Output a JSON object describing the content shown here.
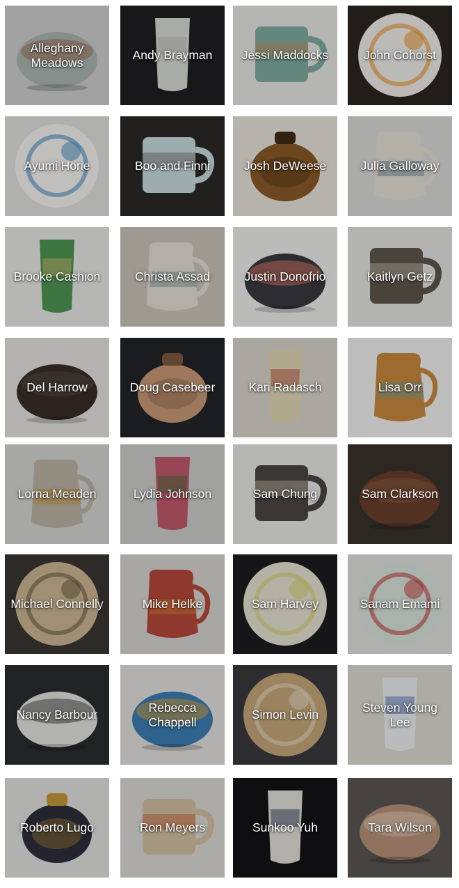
{
  "artists": [
    {
      "name": "Alleghany Meadows",
      "colors": {
        "bg": "#cfd0cf",
        "piece": "#aeb8b4",
        "accent": "#9c7156"
      },
      "shape": "bowl"
    },
    {
      "name": "Andy Brayman",
      "colors": {
        "bg": "#1f1f22",
        "piece": "#d9dbd7",
        "accent": "#b9bcb7"
      },
      "shape": "vase"
    },
    {
      "name": "Jessi Maddocks",
      "colors": {
        "bg": "#e8e8e6",
        "piece": "#7fae9f",
        "accent": "#c9925f"
      },
      "shape": "mug"
    },
    {
      "name": "John Cohorst",
      "colors": {
        "bg": "#2d2620",
        "piece": "#f0efe9",
        "accent": "#e7952d"
      },
      "shape": "plate"
    },
    {
      "name": "Ayumi Horie",
      "colors": {
        "bg": "#e2e2e0",
        "piece": "#f6f5f1",
        "accent": "#4a8fc2"
      },
      "shape": "plate"
    },
    {
      "name": "Boo and Finni",
      "colors": {
        "bg": "#2b2a28",
        "piece": "#c9dde0",
        "accent": "#6b6460"
      },
      "shape": "mug"
    },
    {
      "name": "Josh DeWeese",
      "colors": {
        "bg": "#e9e6de",
        "piece": "#8a5a27",
        "accent": "#3e2b16"
      },
      "shape": "jar"
    },
    {
      "name": "Julia Galloway",
      "colors": {
        "bg": "#dcdcd9",
        "piece": "#e6e2d6",
        "accent": "#5f7d92"
      },
      "shape": "pitcher"
    },
    {
      "name": "Brooke Cashion",
      "colors": {
        "bg": "#e9eae8",
        "piece": "#4f9654",
        "accent": "#d7c06a"
      },
      "shape": "vase"
    },
    {
      "name": "Christa Assad",
      "colors": {
        "bg": "#cbc6bc",
        "piece": "#e5e1d8",
        "accent": "#6f8f8a"
      },
      "shape": "pitcher"
    },
    {
      "name": "Justin Donofrio",
      "colors": {
        "bg": "#f0f0ef",
        "piece": "#3a3a3f",
        "accent": "#e07a6c"
      },
      "shape": "bowl"
    },
    {
      "name": "Kaitlyn Getz",
      "colors": {
        "bg": "#e6e6e4",
        "piece": "#5e574c",
        "accent": "#d5cfc0"
      },
      "shape": "mug"
    },
    {
      "name": "Del Harrow",
      "colors": {
        "bg": "#e6e5e3",
        "piece": "#3a2f2a",
        "accent": "#5a4a40"
      },
      "shape": "bowl"
    },
    {
      "name": "Doug Casebeer",
      "colors": {
        "bg": "#232428",
        "piece": "#c99a78",
        "accent": "#7e5a3f"
      },
      "shape": "jar"
    },
    {
      "name": "Kari Radasch",
      "colors": {
        "bg": "#dad7cf",
        "piece": "#e3d9b5",
        "accent": "#b44a3c"
      },
      "shape": "vase"
    },
    {
      "name": "Lisa Orr",
      "colors": {
        "bg": "#f3f3f2",
        "piece": "#c98a3e",
        "accent": "#6aa3a8"
      },
      "shape": "pitcher"
    },
    {
      "name": "Lorna Meaden",
      "colors": {
        "bg": "#d6d6d4",
        "piece": "#bdb7a6",
        "accent": "#c9922f"
      },
      "shape": "pitcher"
    },
    {
      "name": "Lydia Johnson",
      "colors": {
        "bg": "#cfcfcd",
        "piece": "#c25b6b",
        "accent": "#3e6f3a"
      },
      "shape": "vase"
    },
    {
      "name": "Sam Chung",
      "colors": {
        "bg": "#e9e9e7",
        "piece": "#4a4642",
        "accent": "#d6cbb6"
      },
      "shape": "mug"
    },
    {
      "name": "Sam Clarkson",
      "colors": {
        "bg": "#3a322c",
        "piece": "#6b3f2c",
        "accent": "#8a5a40"
      },
      "shape": "bowl"
    },
    {
      "name": "Michael Connelly",
      "colors": {
        "bg": "#3a3733",
        "piece": "#cdb894",
        "accent": "#6d5a42"
      },
      "shape": "plate"
    },
    {
      "name": "Mike Helke",
      "colors": {
        "bg": "#d8d7d3",
        "piece": "#b8483a",
        "accent": "#e08a3a"
      },
      "shape": "pitcher"
    },
    {
      "name": "Sam Harvey",
      "colors": {
        "bg": "#1d1d1f",
        "piece": "#e7e3d4",
        "accent": "#d9d26a"
      },
      "shape": "plate"
    },
    {
      "name": "Sanam Emami",
      "colors": {
        "bg": "#e2e2e1",
        "piece": "#d9e6dc",
        "accent": "#c23d3d"
      },
      "shape": "plate"
    },
    {
      "name": "Nancy Barbour",
      "colors": {
        "bg": "#2c2d30",
        "piece": "#e4e4e1",
        "accent": "#4a4a48"
      },
      "shape": "bowl"
    },
    {
      "name": "Rebecca Chappell",
      "colors": {
        "bg": "#e4e3e0",
        "piece": "#3d7fb5",
        "accent": "#d9a13b"
      },
      "shape": "bowl"
    },
    {
      "name": "Simon Levin",
      "colors": {
        "bg": "#3a3a3d",
        "piece": "#c7a87a",
        "accent": "#e7dcc6"
      },
      "shape": "plate"
    },
    {
      "name": "Steven Young Lee",
      "colors": {
        "bg": "#dddbd3",
        "piece": "#eef0f2",
        "accent": "#4b6eb0"
      },
      "shape": "vase"
    },
    {
      "name": "Roberto Lugo",
      "colors": {
        "bg": "#e3e3e1",
        "piece": "#2d2f3a",
        "accent": "#c89a3a"
      },
      "shape": "jar"
    },
    {
      "name": "Ron Meyers",
      "colors": {
        "bg": "#dedcd6",
        "piece": "#d5c3a4",
        "accent": "#c7562e"
      },
      "shape": "mug"
    },
    {
      "name": "Sunkoo Yuh",
      "colors": {
        "bg": "#141416",
        "piece": "#e3e1da",
        "accent": "#2e3a52"
      },
      "shape": "vase"
    },
    {
      "name": "Tara Wilson",
      "colors": {
        "bg": "#5a5652",
        "piece": "#b9927a",
        "accent": "#e3d2b9"
      },
      "shape": "bowl"
    }
  ]
}
